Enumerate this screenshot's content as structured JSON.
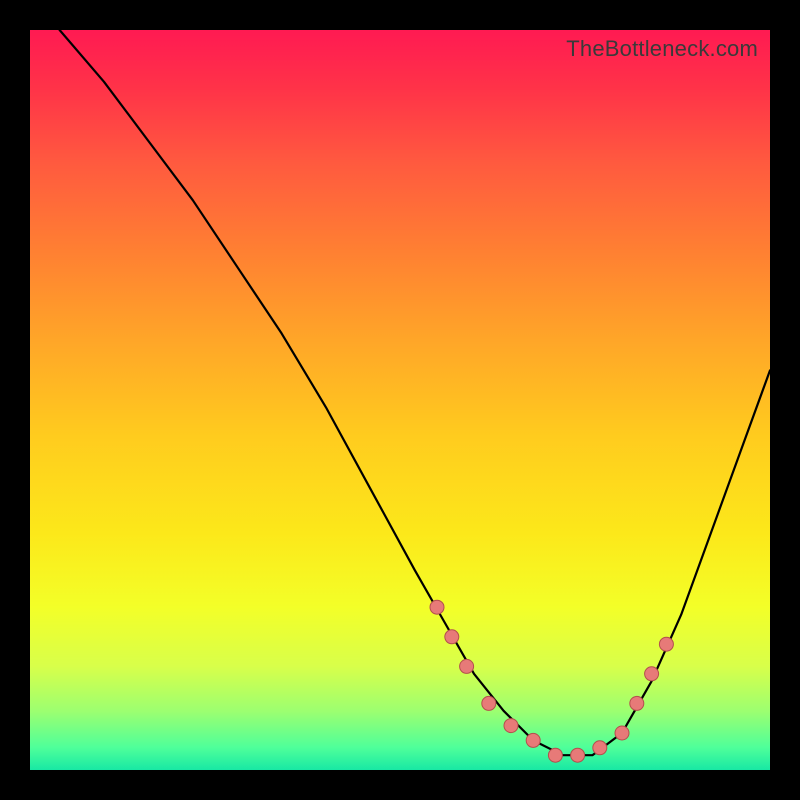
{
  "watermark": "TheBottleneck.com",
  "chart_data": {
    "type": "line",
    "title": "",
    "xlabel": "",
    "ylabel": "",
    "xlim": [
      0,
      100
    ],
    "ylim": [
      0,
      100
    ],
    "series": [
      {
        "name": "curve",
        "x": [
          4,
          10,
          16,
          22,
          28,
          34,
          40,
          46,
          52,
          56,
          60,
          64,
          68,
          72,
          76,
          80,
          84,
          88,
          92,
          96,
          100
        ],
        "y": [
          100,
          93,
          85,
          77,
          68,
          59,
          49,
          38,
          27,
          20,
          13,
          8,
          4,
          2,
          2,
          5,
          12,
          21,
          32,
          43,
          54
        ]
      }
    ],
    "markers": {
      "name": "highlighted-points",
      "x": [
        55,
        57,
        59,
        62,
        65,
        68,
        71,
        74,
        77,
        80,
        82,
        84,
        86
      ],
      "y": [
        22,
        18,
        14,
        9,
        6,
        4,
        2,
        2,
        3,
        5,
        9,
        13,
        17
      ]
    },
    "colors": {
      "curve": "#000000",
      "marker_fill": "#e77a78",
      "marker_stroke": "#b44f4d",
      "gradient_top": "#ff1a52",
      "gradient_bottom": "#18e8a4"
    }
  }
}
